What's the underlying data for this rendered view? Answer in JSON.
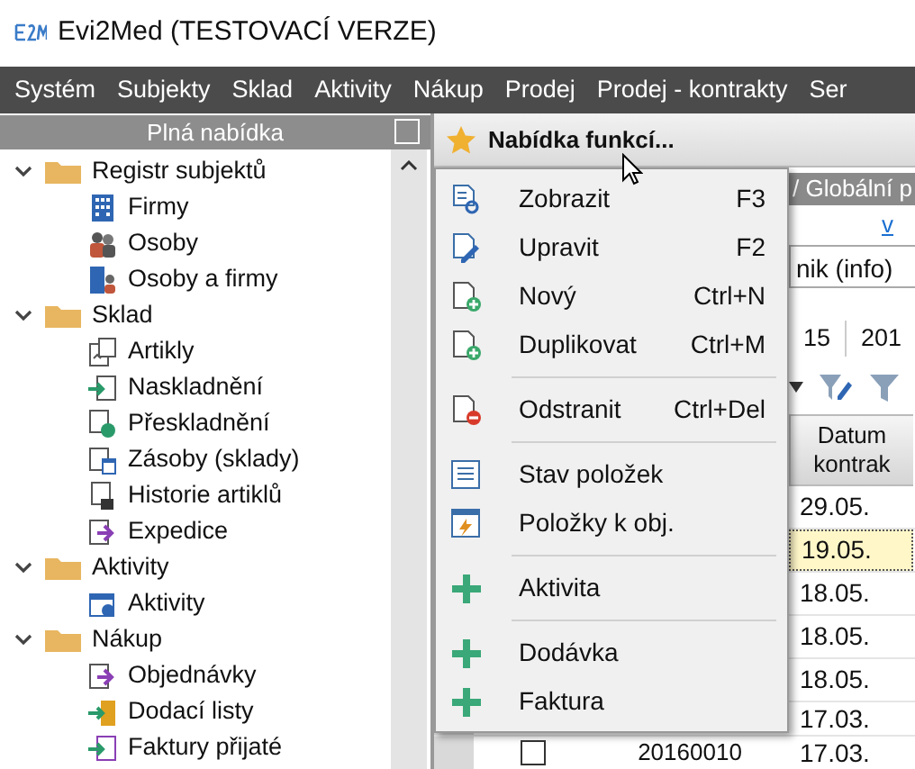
{
  "window": {
    "title": "Evi2Med (TESTOVACÍ VERZE)"
  },
  "menu_bar": [
    "Systém",
    "Subjekty",
    "Sklad",
    "Aktivity",
    "Nákup",
    "Prodej",
    "Prodej - kontrakty",
    "Ser"
  ],
  "sidebar": {
    "title": "Plná nabídka",
    "items": [
      {
        "label": "Registr subjektů",
        "expanded": true,
        "children": [
          {
            "label": "Firmy",
            "kind": "company"
          },
          {
            "label": "Osoby",
            "kind": "person"
          },
          {
            "label": "Osoby a firmy",
            "kind": "person-company"
          }
        ]
      },
      {
        "label": "Sklad",
        "expanded": true,
        "children": [
          {
            "label": "Artikly",
            "kind": "article"
          },
          {
            "label": "Naskladnění",
            "kind": "stock-in"
          },
          {
            "label": "Přeskladnění",
            "kind": "transfer"
          },
          {
            "label": "Zásoby (sklady)",
            "kind": "stock"
          },
          {
            "label": "Historie artiklů",
            "kind": "history"
          },
          {
            "label": "Expedice",
            "kind": "dispatch"
          }
        ]
      },
      {
        "label": "Aktivity",
        "expanded": true,
        "children": [
          {
            "label": "Aktivity",
            "kind": "activity"
          }
        ]
      },
      {
        "label": "Nákup",
        "expanded": true,
        "children": [
          {
            "label": "Objednávky",
            "kind": "dispatch"
          },
          {
            "label": "Dodací listy",
            "kind": "delivery"
          },
          {
            "label": "Faktury přijaté",
            "kind": "invoice"
          }
        ]
      }
    ]
  },
  "toolbar": {
    "label": "Nabídka funkcí..."
  },
  "context_menu": [
    {
      "kind": "view",
      "label": "Zobrazit",
      "shortcut": "F3"
    },
    {
      "kind": "edit",
      "label": "Upravit",
      "shortcut": "F2"
    },
    {
      "kind": "new",
      "label": "Nový",
      "shortcut": "Ctrl+N"
    },
    {
      "kind": "new",
      "label": "Duplikovat",
      "shortcut": "Ctrl+M"
    },
    {
      "kind": "separator"
    },
    {
      "kind": "delete",
      "label": "Odstranit",
      "shortcut": "Ctrl+Del"
    },
    {
      "kind": "separator"
    },
    {
      "kind": "list",
      "label": "Stav položek"
    },
    {
      "kind": "order",
      "label": "Položky k obj."
    },
    {
      "kind": "separator"
    },
    {
      "kind": "add",
      "label": "Aktivita"
    },
    {
      "kind": "separator"
    },
    {
      "kind": "add",
      "label": "Dodávka"
    },
    {
      "kind": "add",
      "label": "Faktura"
    }
  ],
  "background_panel": {
    "breadcrumb": "/ Globální p",
    "link": "v",
    "field_value": "nik (info)",
    "tabs": [
      "15",
      "201"
    ],
    "table": {
      "column_heading": "Datum kontrak",
      "rows": [
        {
          "date": "29.05.",
          "selected": false
        },
        {
          "date": "19.05.",
          "selected": true
        },
        {
          "date": "18.05.",
          "selected": false
        },
        {
          "date": "18.05.",
          "selected": false
        },
        {
          "date": "18.05.",
          "selected": false
        },
        {
          "date": "17.03.",
          "selected": false
        },
        {
          "date": "17.03.",
          "selected": false,
          "checked": false,
          "number": "20160010"
        }
      ]
    }
  }
}
